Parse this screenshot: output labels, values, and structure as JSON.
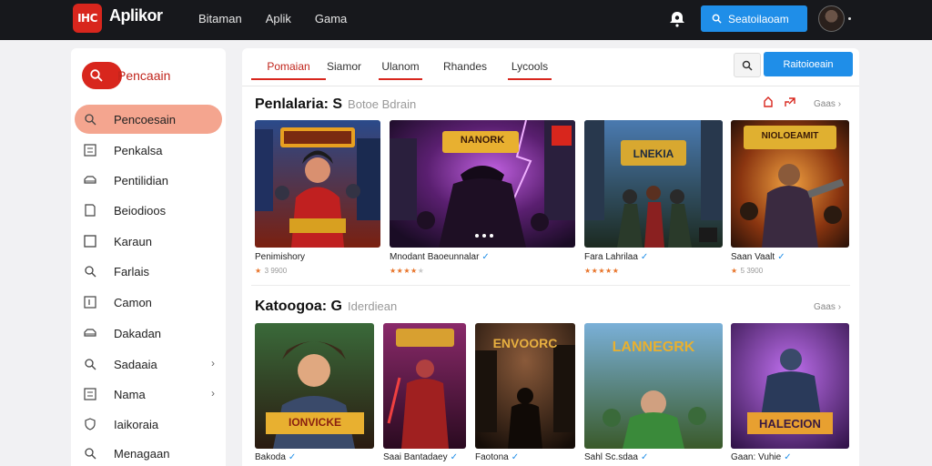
{
  "header": {
    "logo_mark": "IHC",
    "logo_text": "Aplikor",
    "logo_sub": "",
    "nav": [
      "Bitaman",
      "Aplik",
      "Gama"
    ],
    "search_button": "Seatoilaoam"
  },
  "sidebar": {
    "search_label": "Pencaain",
    "items": [
      {
        "label": "Pencoesain",
        "icon": "search-icon",
        "active": true
      },
      {
        "label": "Penkalsa",
        "icon": "list-icon"
      },
      {
        "label": "Pentilidian",
        "icon": "car-icon"
      },
      {
        "label": "Beiodioos",
        "icon": "document-icon"
      },
      {
        "label": "Karaun",
        "icon": "square-icon"
      },
      {
        "label": "Farlais",
        "icon": "search-icon"
      },
      {
        "label": "Camon",
        "icon": "bracket-icon"
      },
      {
        "label": "Dakadan",
        "icon": "car-icon"
      },
      {
        "label": "Sadaaia",
        "icon": "search-icon",
        "chevron": true
      },
      {
        "label": "Nama",
        "icon": "list-icon",
        "chevron": true
      },
      {
        "label": "Iaikoraia",
        "icon": "shield-icon"
      },
      {
        "label": "Menagaan",
        "icon": "search-icon"
      }
    ]
  },
  "tabs": [
    {
      "label": "Pomaian",
      "active": true,
      "underline": true
    },
    {
      "label": "Siamor",
      "active": false,
      "underline": false
    },
    {
      "label": "Ulanom",
      "active": false,
      "underline": true
    },
    {
      "label": "Rhandes",
      "active": false,
      "underline": false
    },
    {
      "label": "Lycools",
      "active": false,
      "underline": true
    }
  ],
  "panel_button": "Raitoioeain",
  "section1": {
    "title": "Penlalaria: S",
    "subtitle": "Botoe Bdrain",
    "more": "Gaas",
    "cards": [
      {
        "title": "Penimishory",
        "verified": false,
        "rating": "",
        "rating_text": "3 9900",
        "stars_full": 1,
        "stars_empty": 0,
        "art": "hero-red"
      },
      {
        "title": "Mnodant Baoeunnalar",
        "verified": true,
        "rating": "",
        "rating_text": "",
        "stars_full": 4,
        "stars_empty": 1,
        "art": "villain-purple"
      },
      {
        "title": "Fara Lahrilaa",
        "verified": true,
        "rating": "",
        "rating_text": "",
        "stars_full": 5,
        "stars_empty": 0,
        "art": "city-battle"
      },
      {
        "title": "Saan Vaalt",
        "verified": true,
        "rating": "",
        "rating_text": "5 3900",
        "stars_full": 1,
        "stars_empty": 0,
        "art": "blaster-orange"
      }
    ],
    "card2_banner": "NANORK",
    "card3_banner": "LNEKIA",
    "card4_banner": "NIOLOEAMIT"
  },
  "section2": {
    "title": "Katoogoa: G",
    "subtitle": "Iderdiean",
    "more": "Gaas",
    "cards": [
      {
        "title": "Bakoda",
        "verified": true,
        "art": "warrior-kid",
        "banner": "IONVICKE"
      },
      {
        "title": "Saai Bantadaey",
        "verified": true,
        "art": "red-warrior",
        "banner": ""
      },
      {
        "title": "Faotona",
        "verified": true,
        "art": "dark-city",
        "banner": "ENVOORC"
      },
      {
        "title": "Sahl Sc.sdaa",
        "verified": true,
        "art": "green-troops",
        "banner": "LANNEGRK"
      },
      {
        "title": "Gaan: Vuhie",
        "verified": true,
        "art": "purple-hero",
        "banner": "HALECION"
      }
    ]
  },
  "colors": {
    "topbar": "#17181c",
    "accent_red": "#d8261d",
    "accent_blue": "#1f8ee8",
    "active_item": "#f4a58f",
    "star": "#e8742a"
  }
}
